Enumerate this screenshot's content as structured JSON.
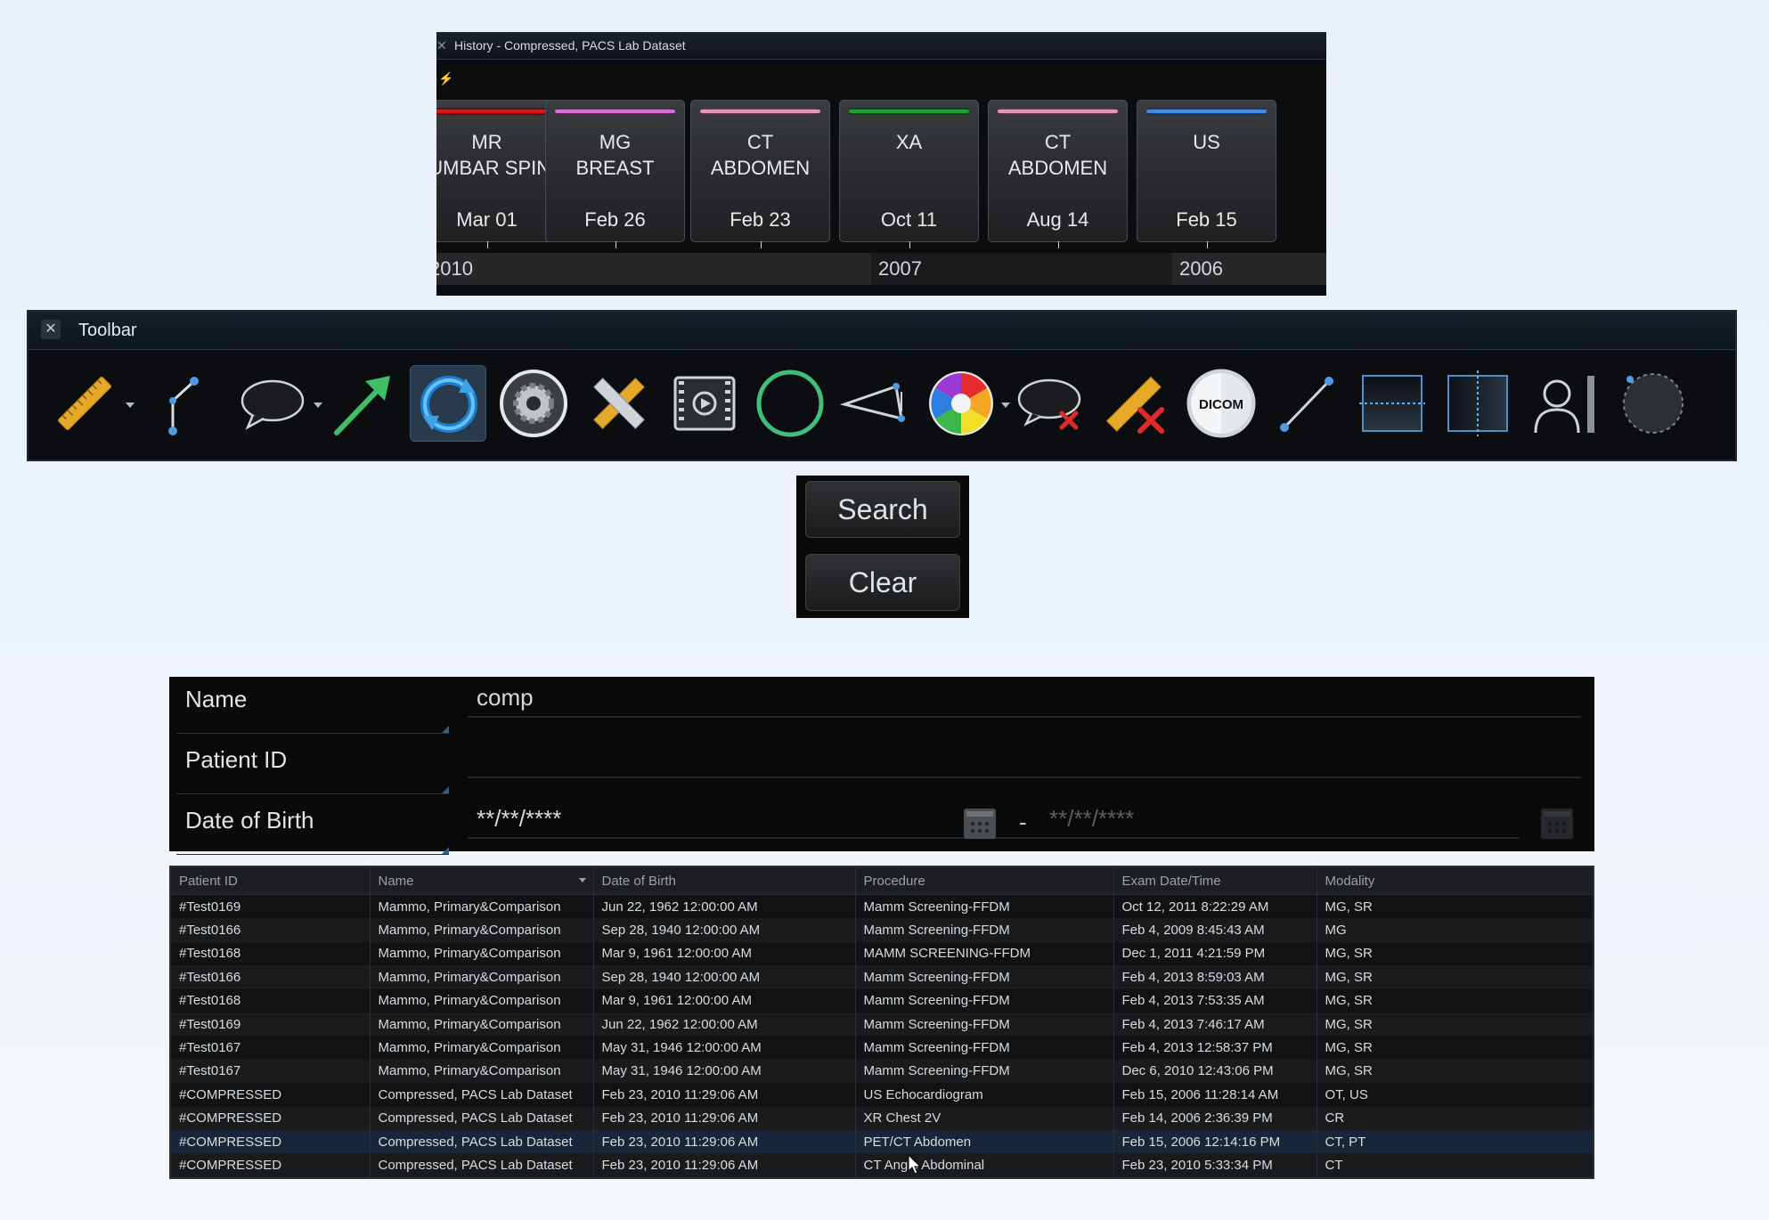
{
  "history": {
    "title": "History - Compressed, PACS Lab Dataset",
    "cards": [
      {
        "modality": "MR",
        "body": "LUMBAR SPINE",
        "date": "Mar 01",
        "color": "#e0121a"
      },
      {
        "modality": "MG",
        "body": "BREAST",
        "date": "Feb 26",
        "color": "#d66fd8"
      },
      {
        "modality": "CT",
        "body": "ABDOMEN",
        "date": "Feb 23",
        "color": "#e996b6"
      },
      {
        "modality": "XA",
        "body": "",
        "date": "Oct 11",
        "color": "#1aa438"
      },
      {
        "modality": "CT",
        "body": "ABDOMEN",
        "date": "Aug 14",
        "color": "#e996b6"
      },
      {
        "modality": "US",
        "body": "",
        "date": "Feb 15",
        "color": "#3c8ee8"
      }
    ],
    "years": [
      "2010",
      "2007",
      "2006"
    ]
  },
  "toolbar": {
    "title": "Toolbar",
    "close": "✕",
    "tools": [
      {
        "name": "ruler-icon",
        "dropdown": true
      },
      {
        "name": "angle-icon",
        "dropdown": false
      },
      {
        "name": "speech-bubble-icon",
        "dropdown": true
      },
      {
        "name": "arrow-icon",
        "dropdown": false
      },
      {
        "name": "sync-icon",
        "dropdown": false,
        "active": true
      },
      {
        "name": "gear-icon",
        "dropdown": false
      },
      {
        "name": "crossed-rulers-icon",
        "dropdown": false
      },
      {
        "name": "film-icon",
        "dropdown": false
      },
      {
        "name": "circle-icon",
        "dropdown": false
      },
      {
        "name": "polygon-icon",
        "dropdown": false
      },
      {
        "name": "color-wheel-icon",
        "dropdown": true
      },
      {
        "name": "delete-annotation-icon",
        "dropdown": false
      },
      {
        "name": "delete-measurement-icon",
        "dropdown": false
      },
      {
        "name": "dicom-icon",
        "dropdown": false,
        "label": "DICOM"
      },
      {
        "name": "line-icon",
        "dropdown": false
      },
      {
        "name": "horizontal-split-icon",
        "dropdown": false
      },
      {
        "name": "vertical-split-icon",
        "dropdown": false
      },
      {
        "name": "patient-info-icon",
        "dropdown": false
      },
      {
        "name": "dotted-circle-icon",
        "dropdown": false
      }
    ]
  },
  "buttons": {
    "search": "Search",
    "clear": "Clear"
  },
  "form": {
    "name_label": "Name",
    "name_value": "comp",
    "pid_label": "Patient ID",
    "pid_value": "",
    "dob_label": "Date of Birth",
    "dob_from": "**/**/****",
    "dob_sep": "-",
    "dob_to": "**/**/****"
  },
  "results": {
    "columns": [
      "Patient ID",
      "Name",
      "Date of Birth",
      "Procedure",
      "Exam Date/Time",
      "Modality"
    ],
    "rows": [
      [
        "#Test0169",
        "Mammo, Primary&Comparison",
        "Jun 22, 1962 12:00:00 AM",
        "Mamm Screening-FFDM",
        "Oct 12, 2011 8:22:29 AM",
        "MG, SR"
      ],
      [
        "#Test0166",
        "Mammo, Primary&Comparison",
        "Sep 28, 1940 12:00:00 AM",
        "Mamm Screening-FFDM",
        "Feb 4, 2009 8:45:43 AM",
        "MG"
      ],
      [
        "#Test0168",
        "Mammo, Primary&Comparison",
        "Mar 9, 1961 12:00:00 AM",
        "MAMM SCREENING-FFDM",
        "Dec 1, 2011 4:21:59 PM",
        "MG, SR"
      ],
      [
        "#Test0166",
        "Mammo, Primary&Comparison",
        "Sep 28, 1940 12:00:00 AM",
        "Mamm Screening-FFDM",
        "Feb 4, 2013 8:59:03 AM",
        "MG, SR"
      ],
      [
        "#Test0168",
        "Mammo, Primary&Comparison",
        "Mar 9, 1961 12:00:00 AM",
        "Mamm Screening-FFDM",
        "Feb 4, 2013 7:53:35 AM",
        "MG, SR"
      ],
      [
        "#Test0169",
        "Mammo, Primary&Comparison",
        "Jun 22, 1962 12:00:00 AM",
        "Mamm Screening-FFDM",
        "Feb 4, 2013 7:46:17 AM",
        "MG, SR"
      ],
      [
        "#Test0167",
        "Mammo, Primary&Comparison",
        "May 31, 1946 12:00:00 AM",
        "Mamm Screening-FFDM",
        "Feb 4, 2013 12:58:37 PM",
        "MG, SR"
      ],
      [
        "#Test0167",
        "Mammo, Primary&Comparison",
        "May 31, 1946 12:00:00 AM",
        "Mamm Screening-FFDM",
        "Dec 6, 2010 12:43:06 PM",
        "MG, SR"
      ],
      [
        "#COMPRESSED",
        "Compressed, PACS Lab Dataset",
        "Feb 23, 2010 11:29:06 AM",
        "US Echocardiogram",
        "Feb 15, 2006 11:28:14 AM",
        "OT, US"
      ],
      [
        "#COMPRESSED",
        "Compressed, PACS Lab Dataset",
        "Feb 23, 2010 11:29:06 AM",
        "XR Chest 2V",
        "Feb 14, 2006 2:36:39 PM",
        "CR"
      ],
      [
        "#COMPRESSED",
        "Compressed, PACS Lab Dataset",
        "Feb 23, 2010 11:29:06 AM",
        "PET/CT Abdomen",
        "Feb 15, 2006 12:14:16 PM",
        "CT, PT"
      ],
      [
        "#COMPRESSED",
        "Compressed, PACS Lab Dataset",
        "Feb 23, 2010 11:29:06 AM",
        "CT Angio Abdominal",
        "Feb 23, 2010 5:33:34 PM",
        "CT"
      ]
    ],
    "selected_row": 10
  }
}
